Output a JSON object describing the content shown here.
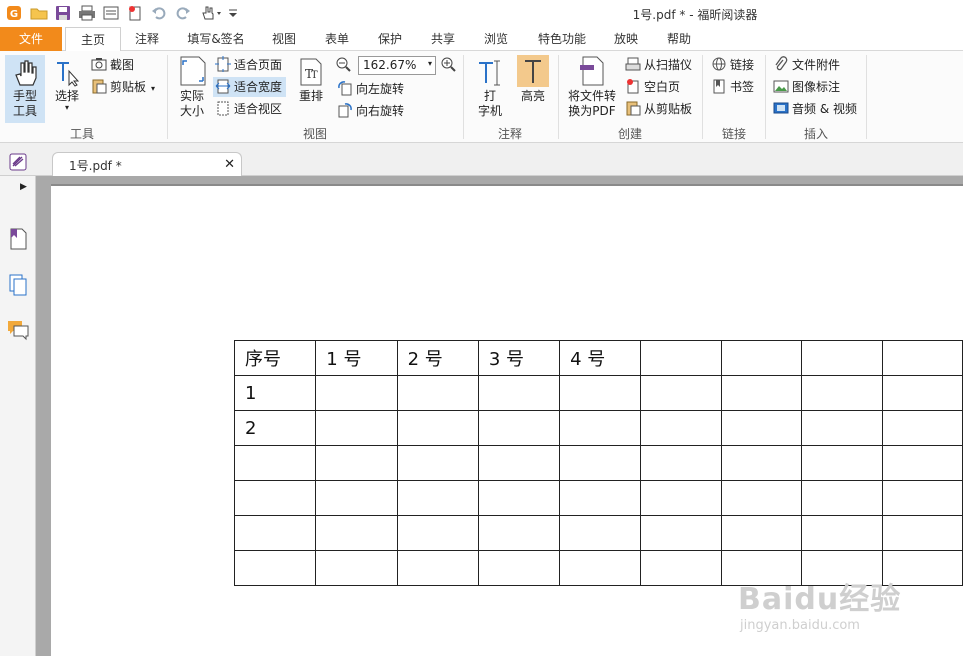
{
  "window": {
    "title": "1号.pdf * - 福昕阅读器"
  },
  "menu_tabs": [
    {
      "label": "文件"
    },
    {
      "label": "主页"
    },
    {
      "label": "注释"
    },
    {
      "label": "填写&签名"
    },
    {
      "label": "视图"
    },
    {
      "label": "表单"
    },
    {
      "label": "保护"
    },
    {
      "label": "共享"
    },
    {
      "label": "浏览"
    },
    {
      "label": "特色功能"
    },
    {
      "label": "放映"
    },
    {
      "label": "帮助"
    }
  ],
  "ribbon": {
    "tools_group": {
      "label": "工具",
      "hand_tool": "手型\n工具",
      "select": "选择",
      "screenshot": "截图",
      "clipboard": "剪贴板"
    },
    "view_group": {
      "label": "视图",
      "actual_size": "实际\n大小",
      "fit_page": "适合页面",
      "fit_width": "适合宽度",
      "fit_visible": "适合视区",
      "reflow": "重排",
      "zoom_value": "162.67%",
      "rotate_left": "向左旋转",
      "rotate_right": "向右旋转"
    },
    "annotate_group": {
      "label": "注释",
      "typewriter": "打\n字机",
      "highlight": "高亮"
    },
    "create_group": {
      "label": "创建",
      "convert": "将文件转\n换为PDF",
      "from_scanner": "从扫描仪",
      "blank_page": "空白页",
      "from_clipboard": "从剪贴板"
    },
    "link_group": {
      "label": "链接",
      "link": "链接",
      "bookmark": "书签"
    },
    "insert_group": {
      "label": "插入",
      "attachment": "文件附件",
      "image_annotation": "图像标注",
      "audio_video": "音频 & 视频"
    }
  },
  "document_tab": {
    "title": "1号.pdf *"
  },
  "table": {
    "rows": [
      [
        "序号",
        "1 号",
        "2 号",
        "3 号",
        "4 号",
        "",
        "",
        "",
        ""
      ],
      [
        "1",
        "",
        "",
        "",
        "",
        "",
        "",
        "",
        ""
      ],
      [
        "2",
        "",
        "",
        "",
        "",
        "",
        "",
        "",
        ""
      ],
      [
        "",
        "",
        "",
        "",
        "",
        "",
        "",
        "",
        ""
      ],
      [
        "",
        "",
        "",
        "",
        "",
        "",
        "",
        "",
        ""
      ],
      [
        "",
        "",
        "",
        "",
        "",
        "",
        "",
        "",
        ""
      ],
      [
        "",
        "",
        "",
        "",
        "",
        "",
        "",
        "",
        ""
      ]
    ]
  },
  "watermark": {
    "logo": "Baidu经验",
    "url": "jingyan.baidu.com"
  },
  "colors": {
    "file_tab": "#f28a1b",
    "highlight_active": "#f3c98c",
    "selected": "#cfe3f5",
    "doc_background": "#a9a9a9"
  }
}
